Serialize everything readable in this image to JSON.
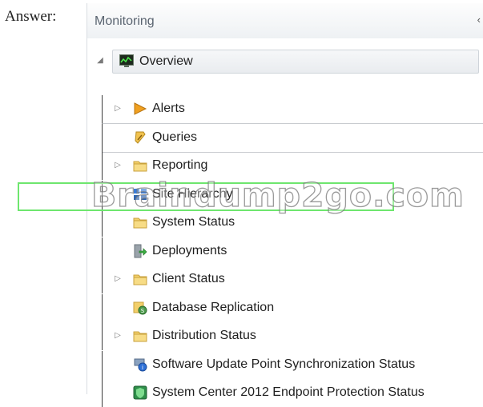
{
  "answer_label": "Answer:",
  "pane": {
    "title": "Monitoring",
    "collapse_glyph": "‹"
  },
  "overview": {
    "label": "Overview",
    "icon": "monitor-icon"
  },
  "items": [
    {
      "label": "Alerts",
      "icon": "alert-flag-icon",
      "expandable": true
    },
    {
      "label": "Queries",
      "icon": "query-icon",
      "expandable": false
    },
    {
      "label": "Reporting",
      "icon": "folder-icon",
      "expandable": true
    },
    {
      "label": "Site Hierarchy",
      "icon": "site-hierarchy-icon",
      "expandable": false
    },
    {
      "label": "System Status",
      "icon": "folder-icon",
      "expandable": false
    },
    {
      "label": "Deployments",
      "icon": "deployment-icon",
      "expandable": false,
      "highlighted": true
    },
    {
      "label": "Client Status",
      "icon": "folder-icon",
      "expandable": true
    },
    {
      "label": "Database Replication",
      "icon": "database-replication-icon",
      "expandable": false
    },
    {
      "label": "Distribution Status",
      "icon": "folder-icon",
      "expandable": true
    },
    {
      "label": "Software Update Point Synchronization Status",
      "icon": "update-sync-icon",
      "expandable": false
    },
    {
      "label": "System Center 2012 Endpoint Protection Status",
      "icon": "endpoint-protection-icon",
      "expandable": false
    }
  ],
  "watermark": "Braindump2go.com",
  "colors": {
    "highlight": "#6ee66e",
    "folder": "#f2cf6a",
    "alert": "#f0a020"
  }
}
